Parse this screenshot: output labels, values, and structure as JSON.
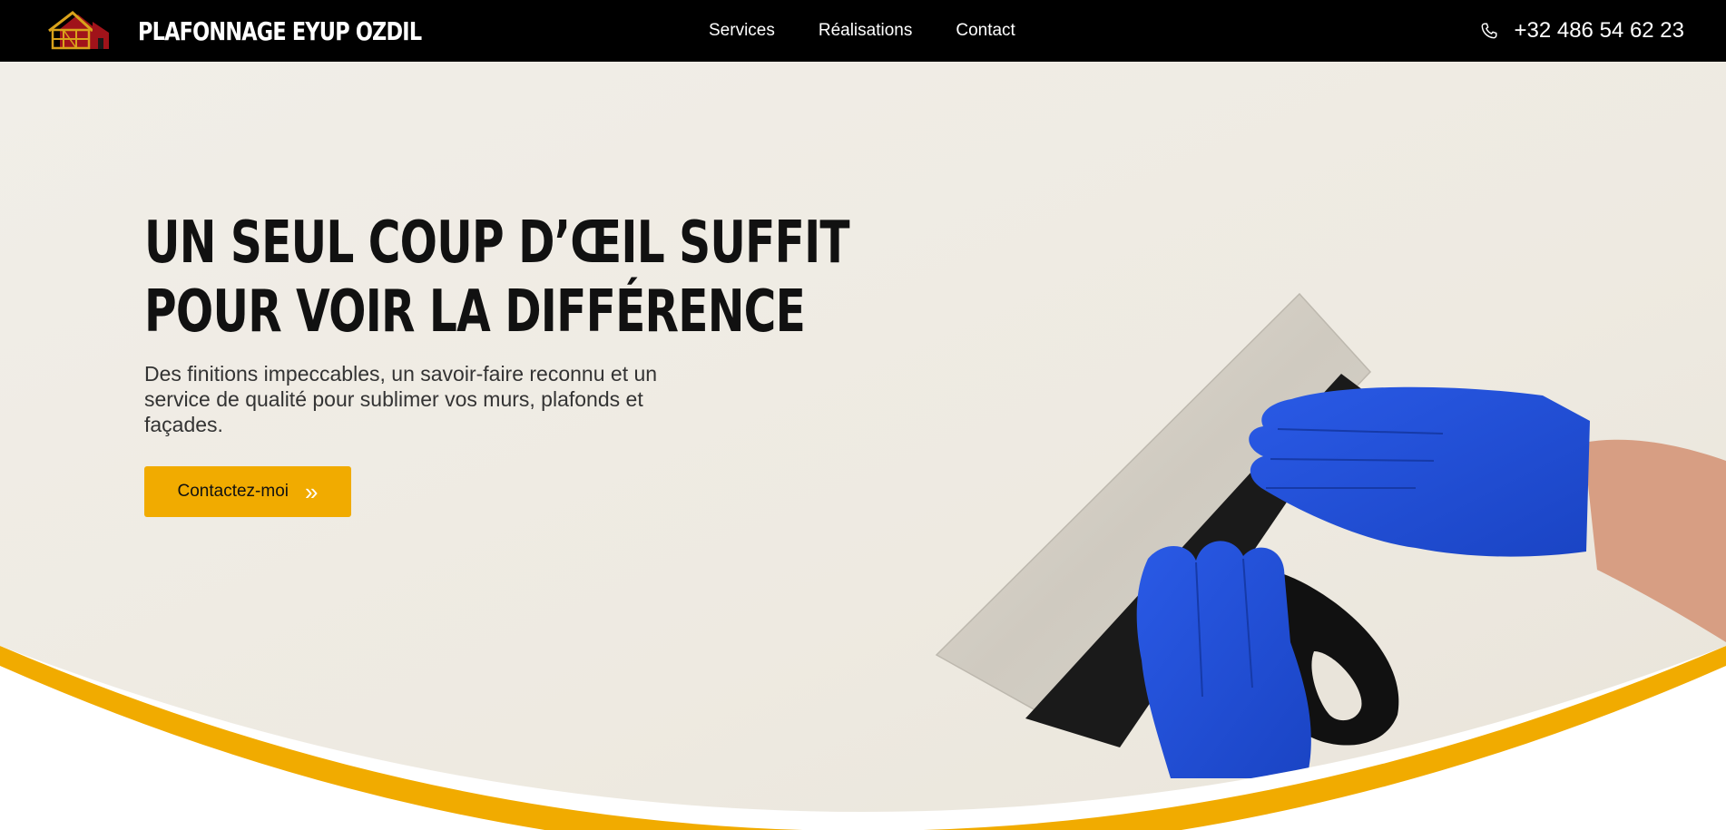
{
  "header": {
    "brand_name": "PLAFONNAGE EYUP OZDIL",
    "logo_icon": "house-logo-icon",
    "nav": [
      {
        "label": "Services"
      },
      {
        "label": "Réalisations"
      },
      {
        "label": "Contact"
      }
    ],
    "phone_icon": "phone-icon",
    "phone": "+32 486 54 62 23"
  },
  "hero": {
    "title_line1": "UN SEUL COUP D’ŒIL SUFFIT",
    "title_line2": "POUR VOIR LA DIFFÉRENCE",
    "subtitle": "Des finitions impeccables, un savoir-faire reconnu et un service de qualité pour sublimer vos murs, plafonds et façades.",
    "cta_label": "Contactez-moi",
    "cta_icon": "double-chevron-right-icon",
    "image": "gloved-hands-holding-putty-knife"
  },
  "colors": {
    "accent": "#f1ab00",
    "header_bg": "#000000",
    "hero_bg": "#efebe3",
    "glove": "#1f4fd6"
  }
}
